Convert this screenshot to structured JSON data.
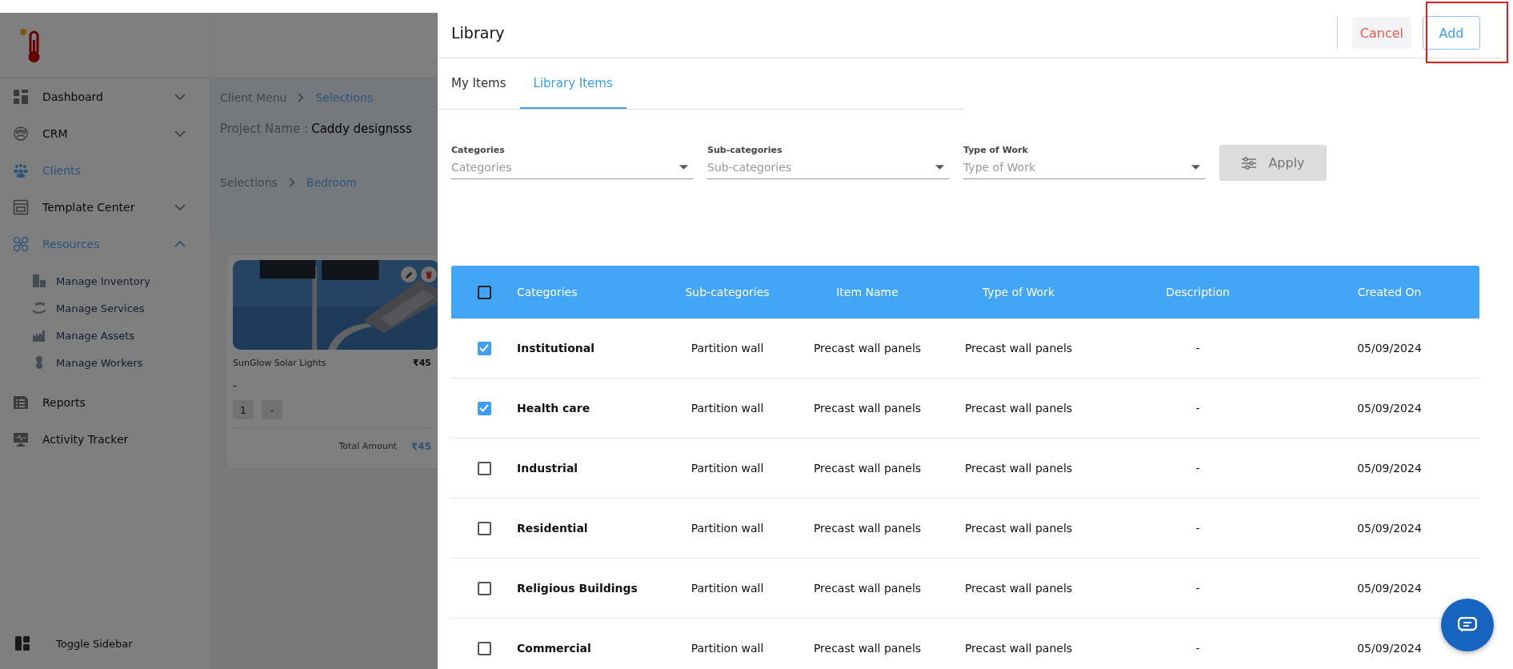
{
  "backdrop": {
    "sidebar": {
      "items": [
        {
          "label": "Dashboard",
          "kind": "group",
          "expanded": false,
          "selected": false
        },
        {
          "label": "CRM",
          "kind": "group",
          "expanded": false,
          "selected": false
        },
        {
          "label": "Clients",
          "kind": "link",
          "selected": true
        },
        {
          "label": "Template Center",
          "kind": "group",
          "expanded": false,
          "selected": false
        },
        {
          "label": "Resources",
          "kind": "group",
          "expanded": true,
          "selected": true,
          "children": [
            {
              "label": "Manage Inventory"
            },
            {
              "label": "Manage Services"
            },
            {
              "label": "Manage Assets"
            },
            {
              "label": "Manage Workers"
            }
          ]
        },
        {
          "label": "Reports",
          "kind": "link",
          "selected": false
        },
        {
          "label": "Activity Tracker",
          "kind": "link",
          "selected": false
        }
      ],
      "toggle": "Toggle Sidebar"
    },
    "breadcrumb": [
      "Client Menu",
      "Selections"
    ],
    "project_label": "Project Name :",
    "project_name": "Caddy designsss",
    "sub_breadcrumb": [
      "Selections",
      "Bedroom"
    ],
    "card": {
      "kind": "picture",
      "name": "SunGlow Solar Lights",
      "price": "₹45",
      "description": "-",
      "quantity": "1",
      "minus": "-",
      "total_label": "Total Amount",
      "total": "₹45"
    }
  },
  "drawer": {
    "title": "Library",
    "cancel": "Cancel",
    "add": "Add",
    "tabs": [
      {
        "label": "My Items",
        "selected": false
      },
      {
        "label": "Library Items",
        "selected": true
      }
    ],
    "filters": [
      {
        "label": "Categories",
        "placeholder": "Categories"
      },
      {
        "label": "Sub-categories",
        "placeholder": "Sub-categories"
      },
      {
        "label": "Type of Work",
        "placeholder": "Type of Work"
      }
    ],
    "apply": {
      "label": "Apply",
      "disabled": true
    },
    "table": {
      "all_checked": false,
      "columns": [
        "Categories",
        "Sub-categories",
        "Item Name",
        "Type of Work",
        "Description",
        "Created On"
      ],
      "rows": [
        {
          "checked": true,
          "category": "Institutional",
          "subcategory": "Partition wall",
          "item_name": "Precast wall panels",
          "type_of_work": "Precast wall panels",
          "description": "-",
          "created_on": "05/09/2024"
        },
        {
          "checked": true,
          "category": "Health care",
          "subcategory": "Partition wall",
          "item_name": "Precast wall panels",
          "type_of_work": "Precast wall panels",
          "description": "-",
          "created_on": "05/09/2024"
        },
        {
          "checked": false,
          "category": "Industrial",
          "subcategory": "Partition wall",
          "item_name": "Precast wall panels",
          "type_of_work": "Precast wall panels",
          "description": "-",
          "created_on": "05/09/2024"
        },
        {
          "checked": false,
          "category": "Residential",
          "subcategory": "Partition wall",
          "item_name": "Precast wall panels",
          "type_of_work": "Precast wall panels",
          "description": "-",
          "created_on": "05/09/2024"
        },
        {
          "checked": false,
          "category": "Religious Buildings",
          "subcategory": "Partition wall",
          "item_name": "Precast wall panels",
          "type_of_work": "Precast wall panels",
          "description": "-",
          "created_on": "05/09/2024"
        },
        {
          "checked": false,
          "category": "Commercial",
          "subcategory": "Partition wall",
          "item_name": "Precast wall panels",
          "type_of_work": "Precast wall panels",
          "description": "-",
          "created_on": "05/09/2024"
        }
      ]
    }
  }
}
